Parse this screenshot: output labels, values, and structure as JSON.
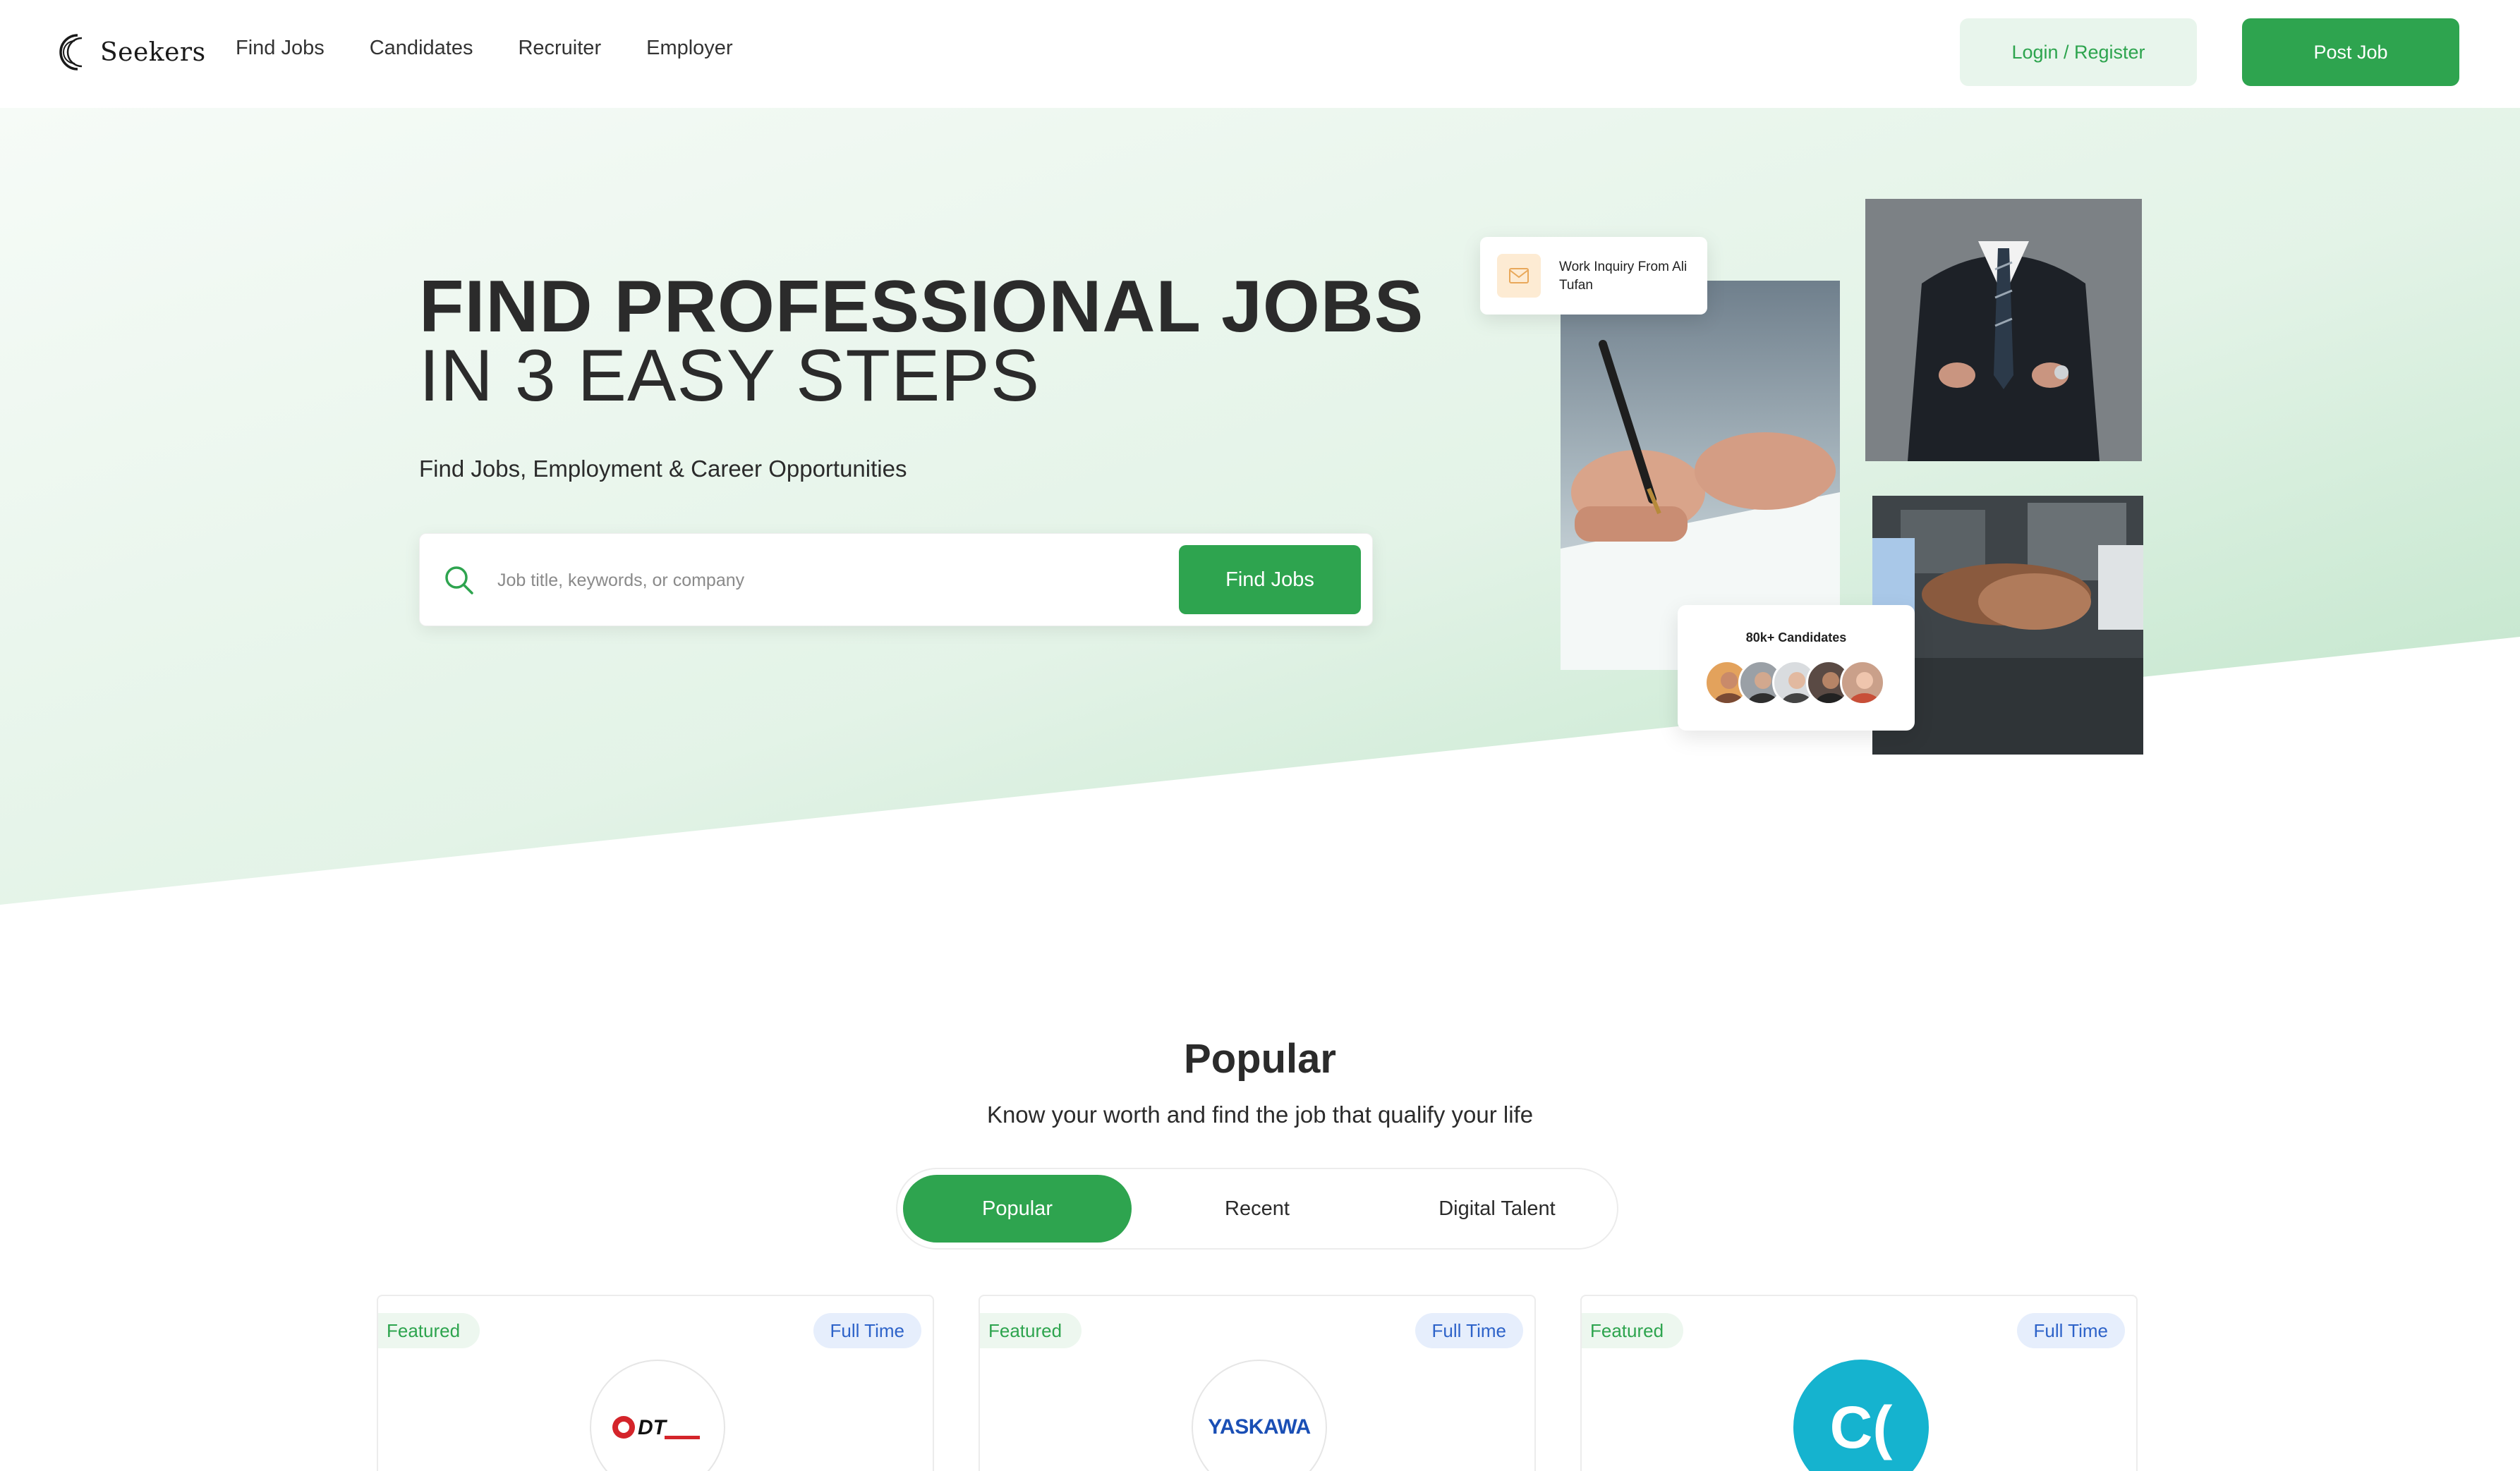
{
  "brand": {
    "name": "Seekers",
    "accent": "#2ea44f"
  },
  "nav": {
    "items": [
      {
        "label": "Find Jobs"
      },
      {
        "label": "Candidates"
      },
      {
        "label": "Recruiter"
      },
      {
        "label": "Employer"
      }
    ],
    "login_label": "Login / Register",
    "post_label": "Post Job"
  },
  "hero": {
    "title_line1": "FIND PROFESSIONAL JOBS",
    "title_line2": "IN 3 EASY STEPS",
    "subtitle": "Find Jobs, Employment & Career Opportunities",
    "search_placeholder": "Job title, keywords, or company",
    "search_button": "Find Jobs",
    "inquiry_card": {
      "text": "Work Inquiry From Ali Tufan",
      "icon": "mail-icon"
    },
    "candidates_card": {
      "title": "80k+ Candidates"
    }
  },
  "popular": {
    "title": "Popular",
    "subtitle": "Know your worth and find the job that qualify your life",
    "tabs": [
      {
        "label": "Popular",
        "active": true
      },
      {
        "label": "Recent",
        "active": false
      },
      {
        "label": "Digital Talent",
        "active": false
      }
    ],
    "jobs": [
      {
        "featured": "Featured",
        "type": "Full Time",
        "logo_text": "DT"
      },
      {
        "featured": "Featured",
        "type": "Full Time",
        "logo_text": "YASKAWA"
      },
      {
        "featured": "Featured",
        "type": "Full Time",
        "logo_text": "C("
      }
    ]
  }
}
